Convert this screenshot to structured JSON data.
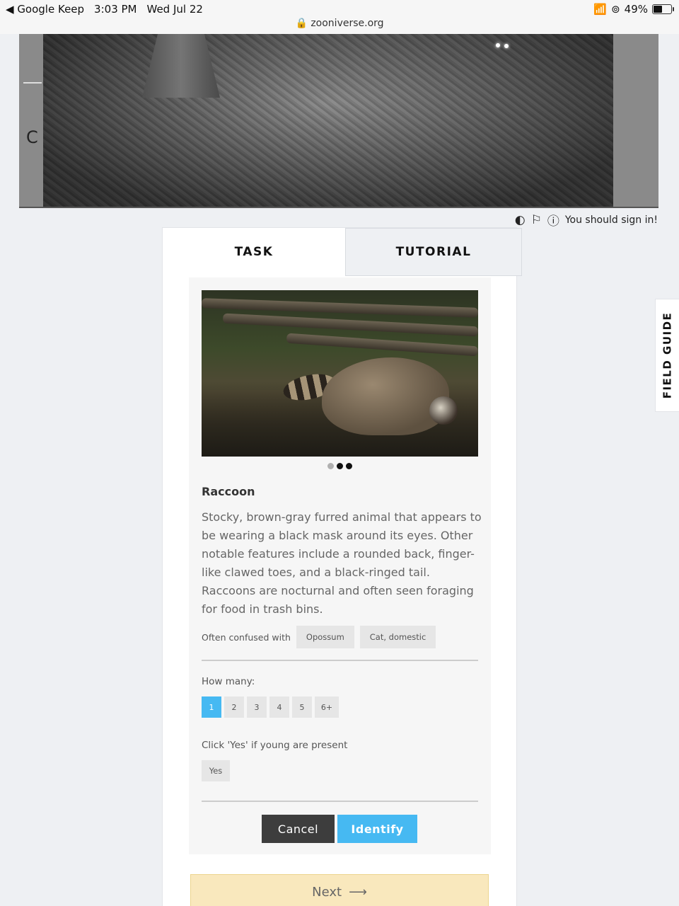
{
  "statusbar": {
    "back_app": "Google Keep",
    "time": "3:03 PM",
    "date": "Wed Jul 22",
    "url": "zooniverse.org",
    "battery": "49%"
  },
  "camera": {
    "frame_letter": "C"
  },
  "toolrow": {
    "sign_in": "You should sign in!"
  },
  "tabs": {
    "task": "TASK",
    "tutorial": "TUTORIAL"
  },
  "card": {
    "species": "Raccoon",
    "description": "Stocky, brown-gray furred animal that appears to be wearing a black mask around its eyes. Other notable features include a rounded back, finger-like clawed toes, and a black-ringed tail. Raccoons are nocturnal and often seen foraging for food in trash bins.",
    "confused_label": "Often confused with",
    "confused_with": [
      "Opossum",
      "Cat, domestic"
    ],
    "how_many_label": "How many:",
    "counts": [
      "1",
      "2",
      "3",
      "4",
      "5",
      "6+"
    ],
    "young_label": "Click 'Yes' if young are present",
    "yes": "Yes",
    "cancel": "Cancel",
    "identify": "Identify"
  },
  "next": {
    "label": "Next",
    "arrow": "⟶"
  },
  "field_guide": "FIELD GUIDE"
}
